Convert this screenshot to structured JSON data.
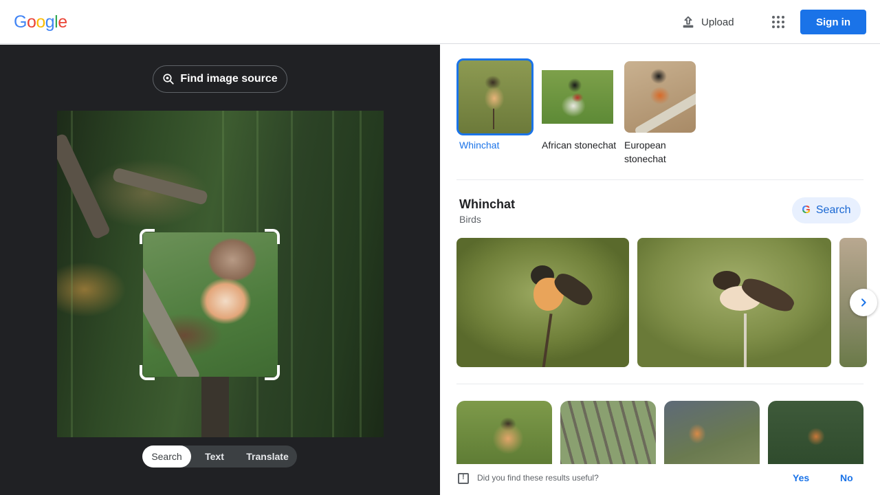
{
  "header": {
    "logo_letters": [
      "G",
      "o",
      "o",
      "g",
      "l",
      "e"
    ],
    "logo_colors": [
      "#4285f4",
      "#ea4335",
      "#fbbc05",
      "#4285f4",
      "#34a853",
      "#ea4335"
    ],
    "upload_label": "Upload",
    "upload_icon": "upload-icon",
    "apps_icon": "apps-grid-icon",
    "signin_label": "Sign in",
    "accent_color": "#1a73e8"
  },
  "left_pane": {
    "find_source_label": "Find image source",
    "find_source_icon": "lens-search-icon",
    "modes": [
      "Search",
      "Text",
      "Translate"
    ],
    "active_mode": "Search"
  },
  "right_pane": {
    "suggestions": [
      {
        "label": "Whinchat",
        "selected": true
      },
      {
        "label": "African stonechat",
        "selected": false
      },
      {
        "label": "European stonechat",
        "selected": false
      }
    ],
    "knowledge_panel": {
      "title": "Whinchat",
      "subtitle": "Birds",
      "search_label": "Search"
    },
    "feedback": {
      "question": "Did you find these results useful?",
      "yes_label": "Yes",
      "no_label": "No"
    }
  }
}
